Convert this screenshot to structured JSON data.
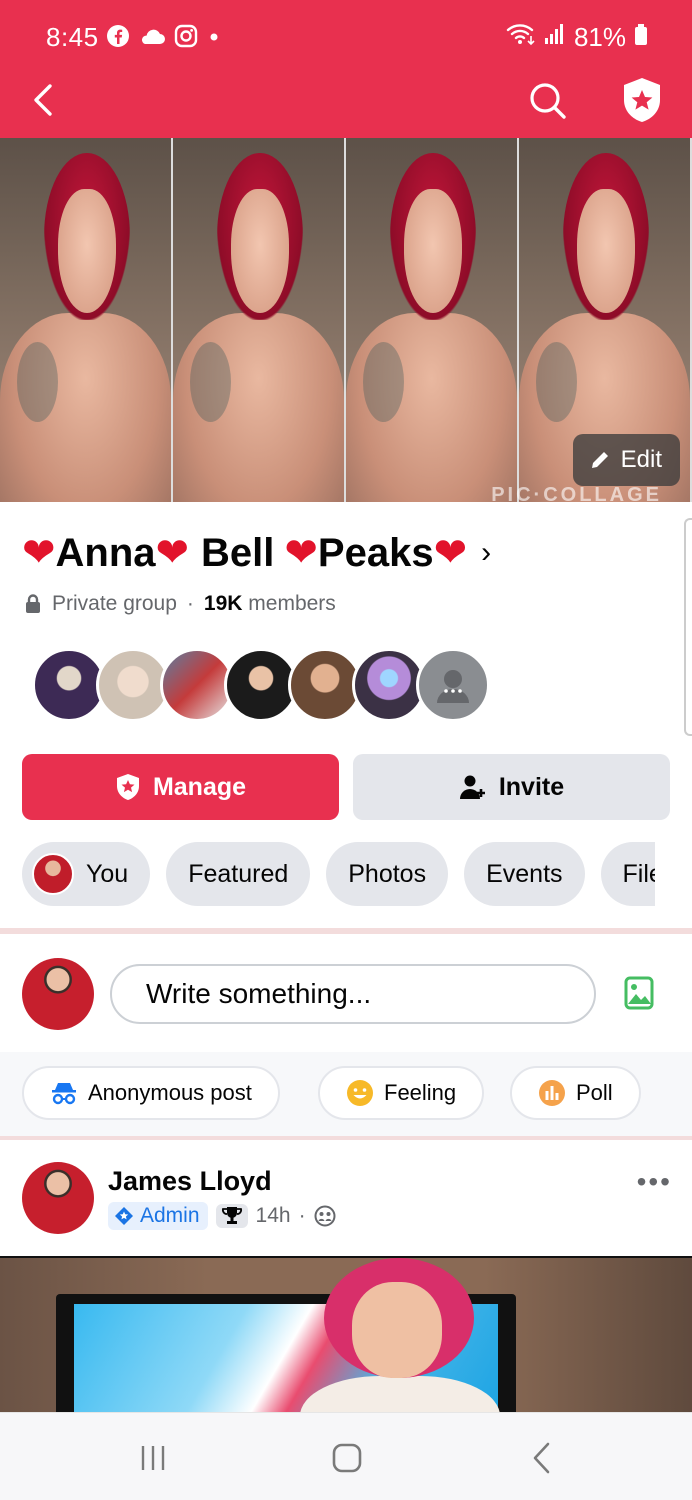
{
  "status_bar": {
    "time": "8:45",
    "battery": "81%",
    "notification_icons": [
      "facebook-icon",
      "cloud-icon",
      "instagram-icon",
      "dot-icon"
    ],
    "system_icons": [
      "wifi-icon",
      "signal-icon",
      "battery-icon"
    ]
  },
  "header": {
    "back_icon": "chevron-left-icon",
    "search_icon": "search-icon",
    "admin_icon": "shield-star-icon",
    "accent_color": "#e8304f"
  },
  "cover": {
    "edit_label": "Edit",
    "watermark": "PIC·COLLAGE",
    "panels": 4
  },
  "group": {
    "name_parts": [
      "Anna",
      "Bell",
      "Peaks"
    ],
    "privacy": "Private group",
    "separator": "·",
    "member_count": "19K",
    "members_label": "members",
    "member_avatars": 7
  },
  "actions": {
    "manage_label": "Manage",
    "invite_label": "Invite"
  },
  "tabs": [
    {
      "label": "You"
    },
    {
      "label": "Featured"
    },
    {
      "label": "Photos"
    },
    {
      "label": "Events"
    },
    {
      "label": "Files"
    }
  ],
  "composer": {
    "placeholder": "Write something...",
    "photo_icon": "image-icon",
    "options": [
      {
        "label": "Anonymous post",
        "icon": "incognito-icon"
      },
      {
        "label": "Feeling",
        "icon": "smiley-icon"
      },
      {
        "label": "Poll",
        "icon": "poll-icon"
      }
    ]
  },
  "post": {
    "author": "James Lloyd",
    "role": "Admin",
    "time": "14h",
    "separator": "·",
    "audience_icon": "group-icon",
    "more": "•••"
  }
}
